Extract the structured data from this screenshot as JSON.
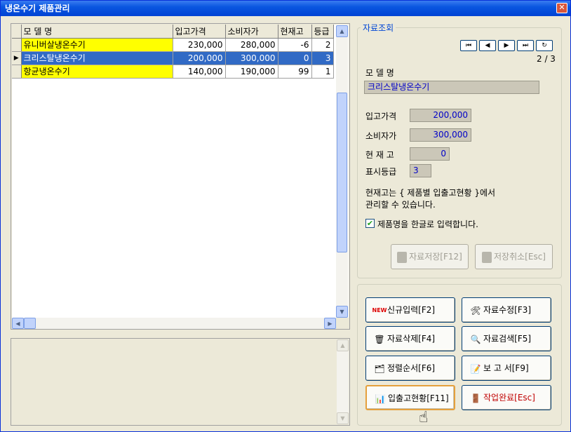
{
  "window": {
    "title": "냉온수기 제품관리",
    "close": "✕"
  },
  "grid": {
    "columns": [
      "모 델 명",
      "입고가격",
      "소비자가",
      "현재고",
      "등급"
    ],
    "rows": [
      {
        "name": "유니버살냉온수기",
        "in_price": "230,000",
        "retail": "280,000",
        "stock": "-6",
        "grade": "2"
      },
      {
        "name": "크리스탈냉온수기",
        "in_price": "200,000",
        "retail": "300,000",
        "stock": "0",
        "grade": "3"
      },
      {
        "name": "항균냉온수기",
        "in_price": "140,000",
        "retail": "190,000",
        "stock": "99",
        "grade": "1"
      }
    ],
    "selected_indicator": "▶"
  },
  "detail": {
    "group_title": "자료조회",
    "nav": {
      "first": "⏮",
      "prev": "◀",
      "next": "▶",
      "last": "⏭",
      "refresh": "↻",
      "position": "2 / 3"
    },
    "model_label": "모 델 명",
    "model_value": "크리스탈냉온수기",
    "in_price_label": "입고가격",
    "in_price_value": "200,000",
    "retail_label": "소비자가",
    "retail_value": "300,000",
    "stock_label": "현 재 고",
    "stock_value": "0",
    "grade_label": "표시등급",
    "grade_value": "3",
    "note_line1": "현재고는 { 제품별 입출고현황 }에서",
    "note_line2": "관리할 수 있습니다.",
    "korean_check_label": "제품명을 한글로 입력합니다.",
    "save_label": "자료저장[F12]",
    "cancel_label": "저장취소[Esc]"
  },
  "actions": {
    "new": "신규입력[F2]",
    "edit": "자료수정[F3]",
    "delete": "자료삭제[F4]",
    "search": "자료검색[F5]",
    "sort": "정렬순서[F6]",
    "report": "보 고 서[F9]",
    "inout": "입출고현황[F11]",
    "done": "작업완료[Esc]",
    "new_badge": "NEW"
  }
}
